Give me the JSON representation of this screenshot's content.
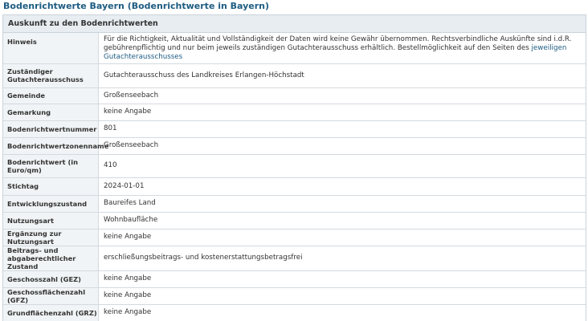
{
  "page_title": "Bodenrichtwerte Bayern (Bodenrichtwerte in Bayern)",
  "panel_header": "Auskunft zu den Bodenrichtwerten",
  "hinweis": {
    "label": "Hinweis",
    "text": "Für die Richtigkeit, Aktualität und Vollständigkeit der Daten wird keine Gewähr übernommen. Rechtsverbindliche Auskünfte sind i.d.R. gebührenpflichtig und nur beim jeweils zuständigen Gutachterausschuss erhältlich. Bestellmöglichkeit auf den Seiten des ",
    "link_text": "jeweiligen Gutachterausschusses"
  },
  "rows": [
    {
      "label": "Zuständiger\nGutachterausschuss",
      "value": "Gutachterausschuss des Landkreises Erlangen-Höchstadt"
    },
    {
      "label": "Gemeinde",
      "value": "Großenseebach"
    },
    {
      "label": "Gemarkung",
      "value": "keine Angabe"
    },
    {
      "label": "Bodenrichtwertnummer",
      "value": "801"
    },
    {
      "label": "Bodenrichtwertzonenname",
      "value": "Großenseebach"
    },
    {
      "label": "Bodenrichtwert (in\nEuro/qm)",
      "value": "410"
    },
    {
      "label": "Stichtag",
      "value": "2024-01-01"
    },
    {
      "label": "Entwicklungszustand",
      "value": "Baureifes Land"
    },
    {
      "label": "Nutzungsart",
      "value": "Wohnbaufläche"
    },
    {
      "label": "Ergänzung zur Nutzungsart",
      "value": "keine Angabe"
    },
    {
      "label": "Beitrags- und\nabgaberechtlicher Zustand",
      "value": "erschließungsbeitrags- und kostenerstattungsbetragsfrei"
    },
    {
      "label": "Geschosszahl (GEZ)",
      "value": "keine Angabe"
    },
    {
      "label": "Geschossflächenzahl (GFZ)",
      "value": "keine Angabe"
    },
    {
      "label": "Grundflächenzahl (GRZ)",
      "value": "keine Angabe"
    }
  ],
  "colors": {
    "title": "#1d5c82",
    "link": "#1d5c82",
    "header_bg": "#e8edf1",
    "label_bg": "#f1f4f6",
    "border": "#c9d3da"
  }
}
